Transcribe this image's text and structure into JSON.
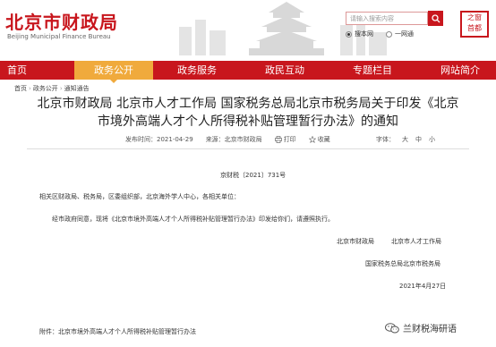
{
  "header": {
    "title": "北京市财政局",
    "subtitle": "Beijing Municipal Finance Bureau",
    "search": {
      "placeholder": "请输入搜索内容"
    },
    "radio": {
      "opt1": "搜本网",
      "opt2": "一网通"
    },
    "seal_text": "之窗首都"
  },
  "nav": {
    "items": [
      "首页",
      "政务公开",
      "政务服务",
      "政民互动",
      "专题栏目",
      "网站简介"
    ]
  },
  "breadcrumb": {
    "home": "首页",
    "section": "政务公开",
    "page": "通知通告"
  },
  "article": {
    "title_line1": "北京市财政局 北京市人才工作局 国家税务总局北京市税务局关于印发《北京",
    "title_line2": "市境外高端人才个人所得税补贴管理暂行办法》的通知",
    "date_label": "发布时间：2021-04-29",
    "source_label": "来源：北京市财政局",
    "print_label": "打印",
    "favorite_label": "收藏",
    "fontsize_label": "字体：",
    "size_large": "大",
    "size_medium": "中",
    "size_small": "小",
    "doc_number": "京财税〔2021〕731号",
    "addressee": "相关区财政局、税务局，区委组织部，北京海外学人中心，各相关单位：",
    "paragraph": "经市政府同意，现将《北京市境外高端人才个人所得税补贴管理暂行办法》印发给你们，请遵照执行。",
    "sign1a": "北京市财政局",
    "sign1b": "北京市人才工作局",
    "sign2": "国家税务总局北京市税务局",
    "sign_date": "2021年4月27日",
    "attachment": "附件：北京市境外高端人才个人所得税补贴管理暂行办法"
  },
  "watermark": {
    "text": "兰财税海研语"
  },
  "colors": {
    "brand_red": "#c8161d",
    "nav_active": "#f0aa3c"
  }
}
